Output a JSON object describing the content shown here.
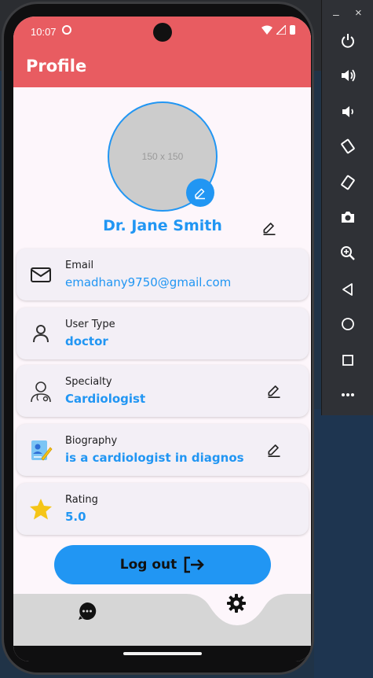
{
  "status_bar": {
    "time": "10:07"
  },
  "appbar": {
    "title": "Profile"
  },
  "profile": {
    "avatar_placeholder": "150 x 150",
    "name": "Dr. Jane Smith"
  },
  "cards": [
    {
      "label": "Email",
      "value": "emadhany9750@gmail.com",
      "icon": "mail-icon"
    },
    {
      "label": "User Type",
      "value": "doctor",
      "icon": "person-icon"
    },
    {
      "label": "Specialty",
      "value": "Cardiologist",
      "icon": "doctor-icon"
    },
    {
      "label": "Biography",
      "value": "is a cardiologist in diagnos",
      "icon": "biography-icon"
    },
    {
      "label": "Rating",
      "value": "5.0",
      "icon": "star-icon"
    }
  ],
  "logout": {
    "label": "Log out"
  },
  "bottom_nav": {
    "items": [
      "chat-icon",
      "settings-icon"
    ]
  },
  "emulator_panel": {
    "window_minimize": "–",
    "window_close": "×",
    "buttons": [
      "power-icon",
      "volume-up-icon",
      "volume-down-icon",
      "rotate-left-icon",
      "rotate-right-icon",
      "camera-icon",
      "zoom-icon",
      "back-icon",
      "home-icon",
      "overview-icon",
      "more-icon"
    ]
  },
  "colors": {
    "appbar": "#e85c61",
    "accent": "#2196f3",
    "background": "#fdf6fb",
    "card": "#f3eff6",
    "star": "#f5c518"
  }
}
